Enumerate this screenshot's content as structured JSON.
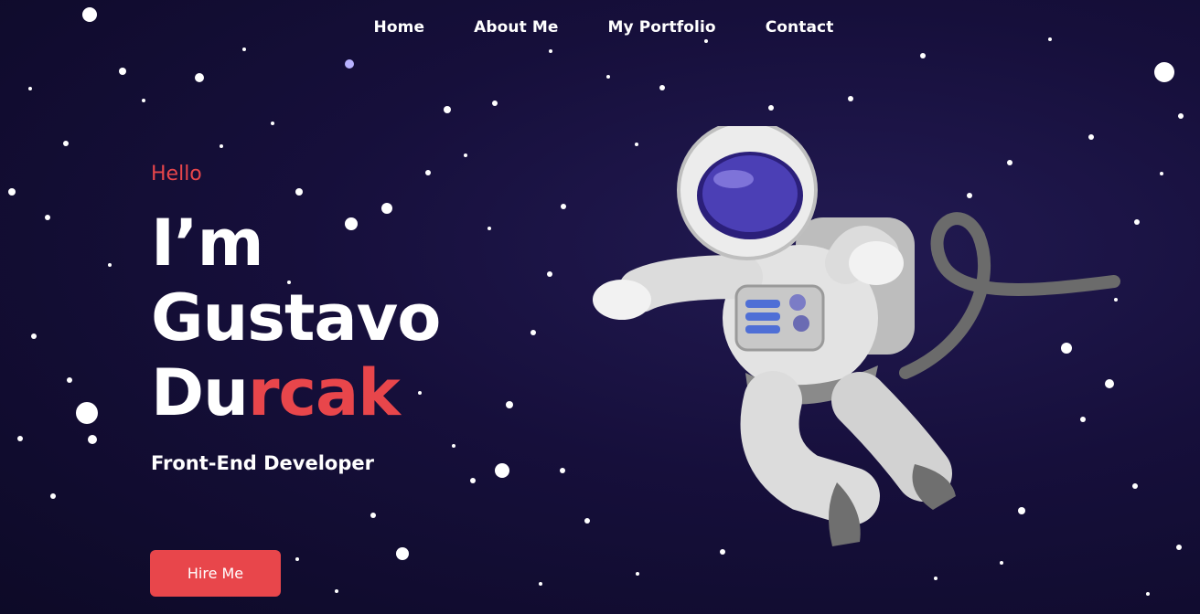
{
  "nav": {
    "items": [
      "Home",
      "About Me",
      "My Portfolio",
      "Contact"
    ]
  },
  "hero": {
    "greeting": "Hello",
    "name_line1": "I’m",
    "name_line2": "Gustavo",
    "name_line3_plain": "Du",
    "name_line3_accent": "rcak",
    "role": "Front-End Developer",
    "cta_label": "Hire Me"
  },
  "colors": {
    "accent": "#e8464b",
    "background": "#160f3b",
    "text": "#ffffff"
  },
  "illustration": "astronaut-floating"
}
